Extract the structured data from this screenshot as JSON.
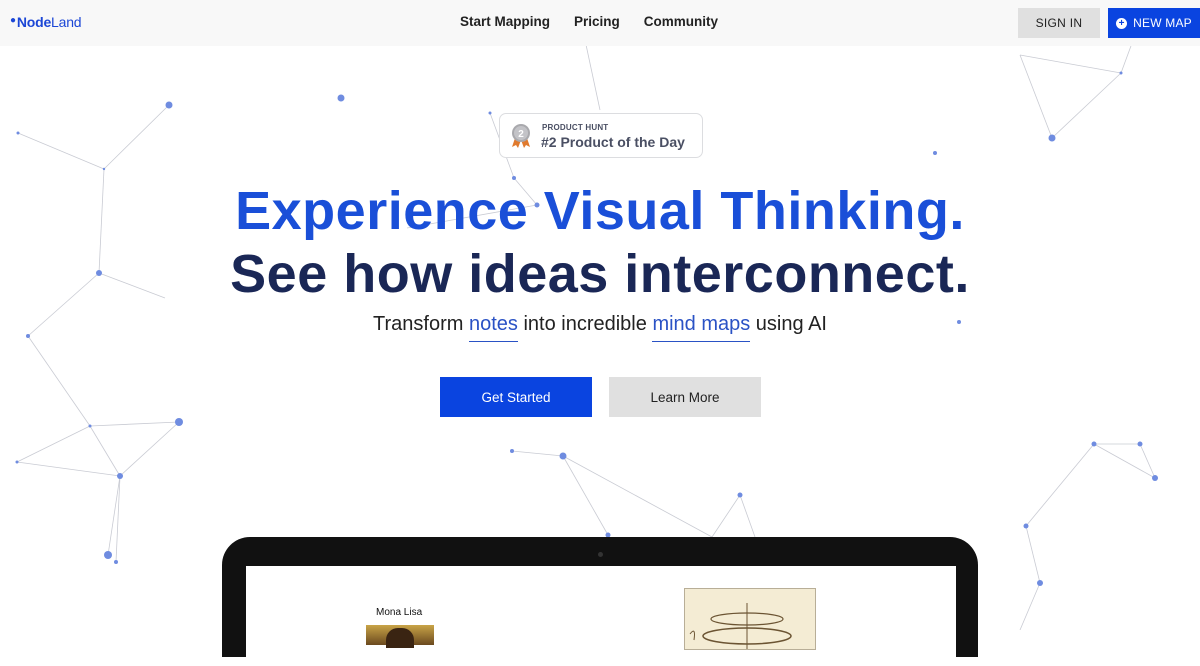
{
  "nav": {
    "logo_node": "Node",
    "logo_land": "Land",
    "links": [
      "Start Mapping",
      "Pricing",
      "Community"
    ],
    "sign_in": "SIGN IN",
    "new_map": "NEW MAP",
    "new_map_icon": "plus-circle-icon"
  },
  "badge": {
    "icon": "silver-medal-icon",
    "medal_number": "2",
    "label_small": "PRODUCT HUNT",
    "label_main": "#2 Product of the Day"
  },
  "hero": {
    "line1": "Experience Visual Thinking.",
    "line2": "See how ideas interconnect.",
    "subtitle_parts": [
      "Transform ",
      "notes",
      " into incredible ",
      "mind maps",
      " using AI"
    ]
  },
  "cta": {
    "primary": "Get Started",
    "secondary": "Learn More"
  },
  "preview": {
    "node1_label": "Mona Lisa"
  },
  "colors": {
    "brand_blue": "#0a44e0",
    "headline_blue": "#1a4fd8",
    "headline_navy": "#1a2756",
    "node_dot": "#6f8ce0"
  }
}
